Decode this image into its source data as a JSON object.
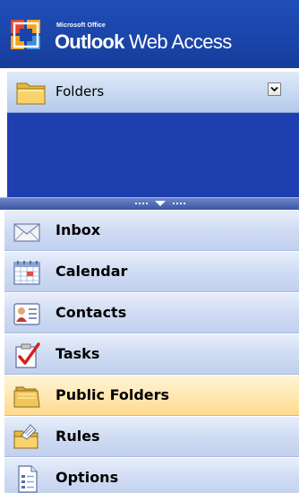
{
  "header": {
    "brand_small": "Microsoft Office",
    "brand_main_strong": "Outlook",
    "brand_main_rest": " Web Access"
  },
  "folders_bar": {
    "label": "Folders"
  },
  "nav": {
    "items": [
      {
        "label": "Inbox",
        "icon": "inbox-icon"
      },
      {
        "label": "Calendar",
        "icon": "calendar-icon"
      },
      {
        "label": "Contacts",
        "icon": "contacts-icon"
      },
      {
        "label": "Tasks",
        "icon": "tasks-icon"
      },
      {
        "label": "Public Folders",
        "icon": "public-folders-icon",
        "selected": true
      },
      {
        "label": "Rules",
        "icon": "rules-icon"
      },
      {
        "label": "Options",
        "icon": "options-icon"
      }
    ]
  },
  "colors": {
    "header_blue": "#1a44a8",
    "tree_blue": "#1e3fb0",
    "nav_item": "#d0dcf3",
    "nav_selected": "#ffe7b0"
  }
}
